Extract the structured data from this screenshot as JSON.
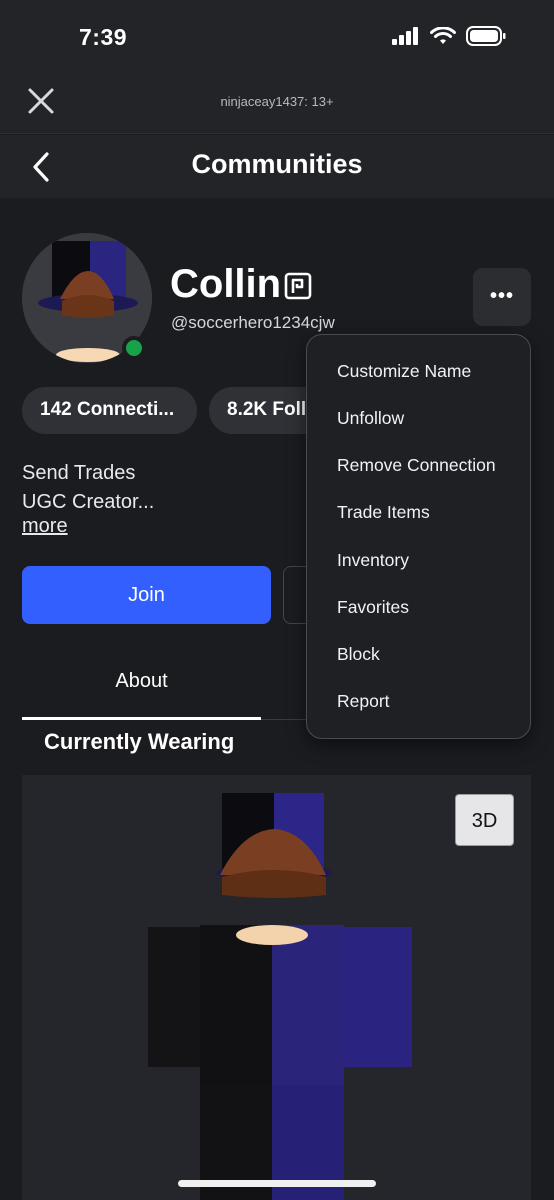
{
  "status_bar": {
    "time": "7:39",
    "icons": [
      "cellular-signal-icon",
      "wifi-icon",
      "battery-icon"
    ]
  },
  "top_bar": {
    "title": "ninjaceay1437: 13+",
    "close_icon": "close-icon"
  },
  "nav": {
    "back_icon": "chevron-left-icon",
    "title": "Communities"
  },
  "profile": {
    "display_name": "Collin",
    "username": "@soccerhero1234cjw",
    "online": true,
    "connections_label": "142 Connecti...",
    "followers_label": "8.2K Foll",
    "bio_lines": [
      "Send Trades",
      "UGC Creator..."
    ],
    "more_label": "more",
    "join_label": "Join",
    "more_menu_icon": "more-horizontal-icon",
    "dots": "•••"
  },
  "tabs": {
    "about_label": "About"
  },
  "currently_wearing": {
    "title": "Currently Wearing",
    "view_3d_label": "3D"
  },
  "menu": {
    "items": [
      "Customize Name",
      "Unfollow",
      "Remove Connection",
      "Trade Items",
      "Inventory",
      "Favorites",
      "Block",
      "Report"
    ]
  },
  "colors": {
    "background": "#1b1c20",
    "header": "#232427",
    "accent_blue": "#335fff",
    "online_green": "#17a34a",
    "pill": "#303136"
  }
}
